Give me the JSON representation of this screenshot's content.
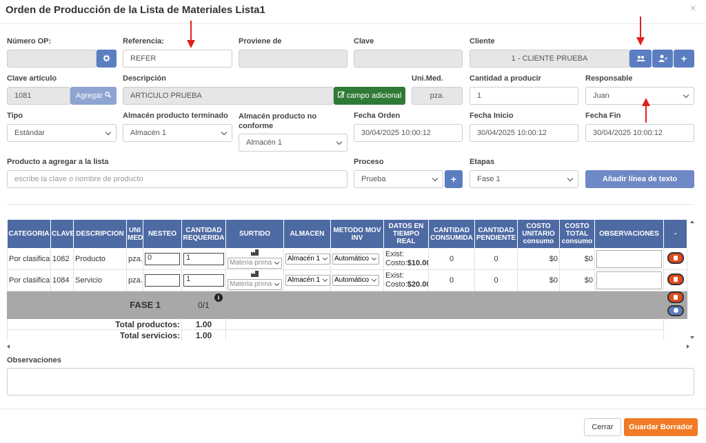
{
  "title": "Orden de Producción de la Lista de Materiales Lista1",
  "close": "×",
  "labels": {
    "numero_op": "Número OP:",
    "referencia": "Referencia:",
    "proviene": "Proviene de",
    "clave": "Clave",
    "cliente": "Cliente",
    "clave_articulo": "Clave artículo",
    "descripcion": "Descripción",
    "unimed": "Uni.Med.",
    "cantidad_producir": "Cantidad a producir",
    "responsable": "Responsable",
    "tipo": "Tipo",
    "almacen_pt": "Almacén producto terminado",
    "almacen_nc": "Almacén producto no conforme",
    "fecha_orden": "Fecha Orden",
    "fecha_inicio": "Fecha Inicio",
    "fecha_fin": "Fecha Fin",
    "producto_agregar": "Producto a agregar a la lista",
    "proceso": "Proceso",
    "etapas": "Etapas",
    "observaciones": "Observaciones"
  },
  "values": {
    "numero_op": "",
    "referencia": "REFER",
    "proviene": "",
    "clave": "",
    "cliente": "1 - CLIENTE PRUEBA",
    "clave_articulo": "1081",
    "descripcion": "ARTICULO PRUEBA",
    "unimed": "pza.",
    "cantidad_producir": "1",
    "responsable": "Juan",
    "tipo": "Estándar",
    "almacen_pt": "Almacén 1",
    "almacen_nc": "Almacén 1",
    "fecha_orden": "30/04/2025 10:00:12",
    "fecha_inicio": "30/04/2025 10:00:12",
    "fecha_fin": "30/04/2025 10:00:12",
    "producto_placeholder": "escribe la clave o nombre de producto",
    "proceso": "Prueba",
    "etapas": "Fase 1"
  },
  "buttons": {
    "agregar": "Agregar",
    "campo_adicional": "campo adicional",
    "anadir_linea": "Añadir línea de texto",
    "cerrar": "Cerrar",
    "guardar": "Guardar Borrador"
  },
  "icons": {
    "gear": "gear-icon",
    "search": "search-icon",
    "users": "users-icon",
    "user_edit": "user-edit-icon",
    "plus": "plus-icon",
    "edit": "edit-icon",
    "warehouse": "warehouse-icon",
    "trash": "trash-icon",
    "clock": "clock-icon",
    "info": "info-icon"
  },
  "colors": {
    "header": "#4d6aa3",
    "button_blue": "#5b7ec0",
    "button_green": "#2f7a35",
    "button_orange": "#f07a25",
    "arrow": "#e02020"
  },
  "table": {
    "headers": [
      "CATEGORIA",
      "CLAVE",
      "DESCRIPCION",
      "UNI MED",
      "NESTEO",
      "CANTIDAD REQUERIDA",
      "SURTIDO",
      "ALMACEN",
      "METODO MOV INV",
      "DATOS EN TIEMPO REAL",
      "CANTIDAD CONSUMIDA",
      "CANTIDAD PENDIENTE",
      "COSTO UNITARIO consumo",
      "COSTO TOTAL consumo",
      "OBSERVACIONES",
      "-"
    ],
    "rows": [
      {
        "categoria": "Por clasificar",
        "clave": "1082",
        "descripcion": "Producto",
        "unimed": "pza.",
        "nesteo": "0",
        "cantidad": "1",
        "surtido": "Materia prima",
        "almacen": "Almacén 1",
        "metodo": "Automático",
        "exist": "Exist:",
        "costo_label": "Costo:",
        "costo": "$10.00",
        "consumida": "0",
        "pendiente": "0",
        "costo_unit": "$0",
        "costo_total": "$0"
      },
      {
        "categoria": "Por clasificar",
        "clave": "1084",
        "descripcion": "Servicio",
        "unimed": "pza.",
        "nesteo": "",
        "cantidad": "1",
        "surtido": "Materia prima",
        "almacen": "Almacén 1",
        "metodo": "Automático",
        "exist": "Exist:",
        "costo_label": "Costo:",
        "costo": "$20.00",
        "consumida": "0",
        "pendiente": "0",
        "costo_unit": "$0",
        "costo_total": "$0"
      }
    ],
    "fase": "FASE 1",
    "fase_count": "0/1",
    "total_productos_label": "Total productos:",
    "total_productos": "1.00",
    "total_servicios_label": "Total servicios:",
    "total_servicios": "1.00"
  }
}
